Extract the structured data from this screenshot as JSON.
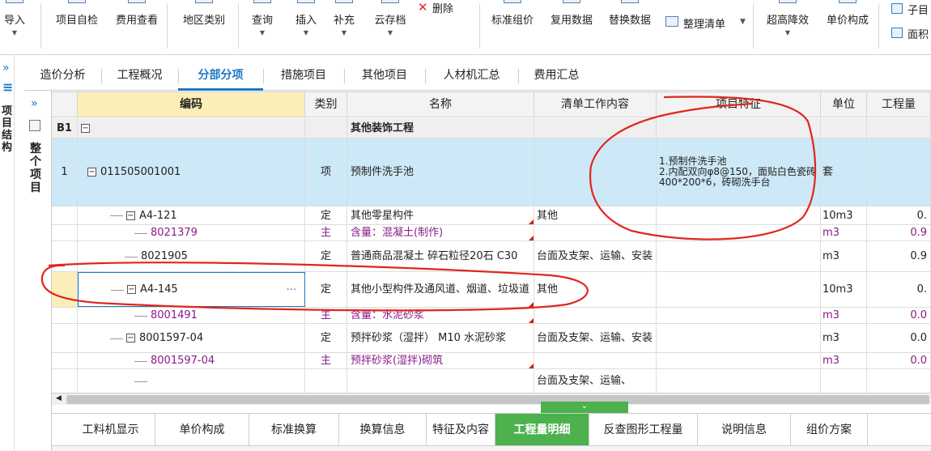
{
  "toolbar": {
    "buttons": [
      {
        "label": "导入",
        "icon": "import-icon",
        "dropdown": true
      },
      {
        "label": "项目自检",
        "icon": "check-icon",
        "dropdown": false
      },
      {
        "label": "费用查看",
        "icon": "cost-view-icon",
        "dropdown": false
      },
      {
        "label": "地区类别",
        "icon": "region-icon",
        "dropdown": false
      },
      {
        "label": "查询",
        "icon": "query-icon",
        "dropdown": true
      },
      {
        "label": "插入",
        "icon": "insert-icon",
        "dropdown": true
      },
      {
        "label": "补充",
        "icon": "supplement-icon",
        "dropdown": true
      },
      {
        "label": "云存档",
        "icon": "cloud-save-icon",
        "dropdown": true
      },
      {
        "label": "删除",
        "icon": "delete-icon",
        "dropdown": false
      },
      {
        "label": "标准组价",
        "icon": "standard-price-icon",
        "dropdown": false
      },
      {
        "label": "复用数据",
        "icon": "reuse-data-icon",
        "dropdown": false
      },
      {
        "label": "替换数据",
        "icon": "replace-data-icon",
        "dropdown": false
      },
      {
        "label": "整理清单",
        "icon": "organize-list-icon",
        "dropdown": true
      },
      {
        "label": "超高降效",
        "icon": "high-rise-icon",
        "dropdown": true
      },
      {
        "label": "单价构成",
        "icon": "unit-price-icon",
        "dropdown": false
      },
      {
        "label": "子目",
        "icon": "sub-item-icon",
        "dropdown": false
      },
      {
        "label": "面积",
        "icon": "area-icon",
        "dropdown": false
      }
    ]
  },
  "left_strip": {
    "label": "项目结构",
    "expand_glyph": "»",
    "menu_glyph": "≡"
  },
  "left_panel": {
    "label": "整个项目",
    "expand_glyph": "»"
  },
  "tabs": [
    "造价分析",
    "工程概况",
    "分部分项",
    "措施项目",
    "其他项目",
    "人材机汇总",
    "费用汇总"
  ],
  "active_tab": "分部分项",
  "grid": {
    "headers": [
      "编码",
      "类别",
      "名称",
      "清单工作内容",
      "项目特征",
      "单位",
      "工程量"
    ],
    "rows": [
      {
        "num": "B1",
        "code": "",
        "type": "",
        "name": "其他装饰工程",
        "work": "",
        "feature": "",
        "unit": "",
        "qty": "",
        "style": "section",
        "expand": "−"
      },
      {
        "num": "1",
        "code": "011505001001",
        "type": "项",
        "name": "预制件洗手池",
        "work": "",
        "feature": "1.预制件洗手池\n2.内配双向φ8@150，面贴白色瓷砖400*200*6，砖砌洗手台",
        "unit": "套",
        "qty": "",
        "style": "item",
        "expand": "−"
      },
      {
        "num": "",
        "code": "A4-121",
        "type": "定",
        "name": "其他零星构件",
        "work": "其他",
        "feature": "",
        "unit": "10m3",
        "qty": "0.",
        "style": "norm",
        "expand": "−"
      },
      {
        "num": "",
        "code": "8021379",
        "type": "主",
        "name": "含量：混凝土(制作)",
        "work": "",
        "feature": "",
        "unit": "m3",
        "qty": "0.9",
        "style": "sub",
        "expand": ""
      },
      {
        "num": "",
        "code": "8021905",
        "type": "定",
        "name": "普通商品混凝土 碎石粒径20石 C30",
        "work": "台面及支架、运输、安装",
        "feature": "",
        "unit": "m3",
        "qty": "0.9",
        "style": "norm2",
        "expand": ""
      },
      {
        "num": "",
        "code": "A4-145",
        "type": "定",
        "name": "其他小型构件及通风道、烟道、垃圾道",
        "work": "其他",
        "feature": "",
        "unit": "10m3",
        "qty": "0.",
        "style": "selected",
        "expand": "−"
      },
      {
        "num": "",
        "code": "8001491",
        "type": "主",
        "name": "含量：水泥砂浆",
        "work": "",
        "feature": "",
        "unit": "m3",
        "qty": "0.0",
        "style": "sub",
        "expand": ""
      },
      {
        "num": "",
        "code": "8001597-04",
        "type": "定",
        "name": "预拌砂浆（湿拌） M10 水泥砂浆",
        "work": "台面及支架、运输、安装",
        "feature": "",
        "unit": "m3",
        "qty": "0.0",
        "style": "norm",
        "expand": "−"
      },
      {
        "num": "",
        "code": "8001597-04",
        "type": "主",
        "name": "预拌砂浆(湿拌)砌筑",
        "work": "",
        "feature": "",
        "unit": "m3",
        "qty": "0.0",
        "style": "sub",
        "expand": ""
      },
      {
        "num": "",
        "code": "",
        "type": "",
        "name": "",
        "work": "台面及支架、运输、",
        "feature": "",
        "unit": "",
        "qty": "",
        "style": "partial",
        "expand": ""
      }
    ],
    "ellipsis": "···"
  },
  "bottom_tabs": [
    "工料机显示",
    "单价构成",
    "标准换算",
    "换算信息",
    "特征及内容",
    "工程量明细",
    "反查图形工程量",
    "说明信息",
    "组价方案"
  ],
  "active_bottom_tab": "工程量明细",
  "colors": {
    "accent_blue": "#1b77c9",
    "selected_row": "#cde8f6",
    "header_yellow": "#fbeeb8",
    "green_tab": "#4db14d",
    "purple_text": "#8a1a8a",
    "annotation_red": "#e0261c"
  }
}
